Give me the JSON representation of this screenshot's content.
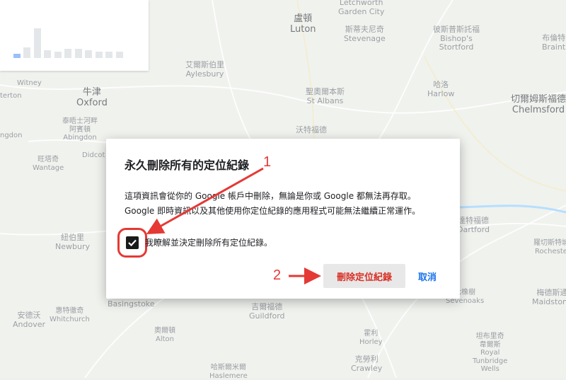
{
  "map": {
    "places": [
      {
        "id": "hitchin",
        "lines": [
          "Letchworth",
          "Garden City"
        ],
        "cls": "minor"
      },
      {
        "id": "luton",
        "lines": [
          "盧頓",
          "Luton"
        ],
        "cls": "major"
      },
      {
        "id": "stevenage",
        "lines": [
          "斯蒂夫尼奇",
          "Stevenage"
        ],
        "cls": "minor"
      },
      {
        "id": "bishops-stortford",
        "lines": [
          "彼斯普斯託福",
          "Bishop's",
          "Stortford"
        ],
        "cls": "minor"
      },
      {
        "id": "braintree",
        "lines": [
          "布倫特",
          "Braint"
        ],
        "cls": "minor"
      },
      {
        "id": "aylesbury",
        "lines": [
          "艾爾斯伯里",
          "Aylesbury"
        ],
        "cls": "minor"
      },
      {
        "id": "harlow",
        "lines": [
          "哈洛",
          "Harlow"
        ],
        "cls": "minor"
      },
      {
        "id": "witney",
        "lines": [
          "Witney"
        ],
        "cls": "small"
      },
      {
        "id": "oxford",
        "lines": [
          "牛津",
          "Oxford"
        ],
        "cls": "major"
      },
      {
        "id": "st-albans",
        "lines": [
          "聖奧爾本斯",
          "St Albans"
        ],
        "cls": "minor"
      },
      {
        "id": "chelmsford",
        "lines": [
          "切爾姆斯福德",
          "Chelmsford"
        ],
        "cls": "major"
      },
      {
        "id": "abingdon",
        "lines": [
          "泰晤士河畔",
          "阿賓頓",
          "Abingdon"
        ],
        "cls": "small"
      },
      {
        "id": "watford",
        "lines": [
          "沃特福德"
        ],
        "cls": "minor"
      },
      {
        "id": "wantage",
        "lines": [
          "旺塔奇",
          "Wantage"
        ],
        "cls": "small"
      },
      {
        "id": "didcot",
        "lines": [
          "Didcot"
        ],
        "cls": "small"
      },
      {
        "id": "newbury",
        "lines": [
          "紐伯里",
          "Newbury"
        ],
        "cls": "minor"
      },
      {
        "id": "dartford",
        "lines": [
          "達特福德",
          "Dartford"
        ],
        "cls": "minor"
      },
      {
        "id": "rochester",
        "lines": [
          "羅切斯特城",
          "Rocheste"
        ],
        "cls": "small"
      },
      {
        "id": "basingstoke",
        "lines": [
          "Basingstoke"
        ],
        "cls": "minor"
      },
      {
        "id": "guildford",
        "lines": [
          "吉爾福德",
          "Guildford"
        ],
        "cls": "minor"
      },
      {
        "id": "sevenoaks",
        "lines": [
          "七橡樹",
          "Sevenoaks"
        ],
        "cls": "small"
      },
      {
        "id": "maidstone",
        "lines": [
          "梅德斯通",
          "Maidstone"
        ],
        "cls": "minor"
      },
      {
        "id": "andover",
        "lines": [
          "安德沃",
          "Andover"
        ],
        "cls": "minor"
      },
      {
        "id": "whitchurch",
        "lines": [
          "惠特徹奇",
          "Whitchurch"
        ],
        "cls": "small"
      },
      {
        "id": "alton",
        "lines": [
          "奧爾頓",
          "Alton"
        ],
        "cls": "small"
      },
      {
        "id": "horley",
        "lines": [
          "霍利",
          "Horley"
        ],
        "cls": "small"
      },
      {
        "id": "tunbridge-wells",
        "lines": [
          "坦布里奇",
          "韋爾斯",
          "Royal",
          "Tunbridge",
          "Wells"
        ],
        "cls": "small"
      },
      {
        "id": "crawley",
        "lines": [
          "克勞利",
          "Crawley"
        ],
        "cls": "minor"
      },
      {
        "id": "haslemere",
        "lines": [
          "哈斯爾米爾",
          "Haslemere"
        ],
        "cls": "small"
      },
      {
        "id": "terton",
        "lines": [
          "terton"
        ],
        "cls": "small"
      },
      {
        "id": "ngdon",
        "lines": [
          "ngdon"
        ],
        "cls": "small"
      }
    ]
  },
  "chart": {
    "bar_levels": [
      0.0,
      0.0,
      0.35,
      0.95,
      0.25,
      0.2,
      0.3,
      0.3,
      0.25,
      0.2,
      0.2,
      0.2
    ],
    "highlight_index": 1
  },
  "dialog": {
    "title": "永久刪除所有的定位紀錄",
    "body_line1": "這項資訊會從你的 Google 帳戶中刪除，無論是你或 Google 都無法再存取。",
    "body_line2": "Google 即時資訊以及其他使用你定位紀錄的應用程式可能無法繼續正常運作。",
    "checkbox_label": "我瞭解並決定刪除所有定位紀錄。",
    "checkbox_checked": true,
    "delete_label": "刪除定位紀錄",
    "cancel_label": "取消"
  },
  "annotations": {
    "step1": "1",
    "step2": "2",
    "color": "#e53935"
  },
  "colors": {
    "danger": "#d93025",
    "accent": "#1a73e8",
    "map_bg": "#eef0eb"
  }
}
